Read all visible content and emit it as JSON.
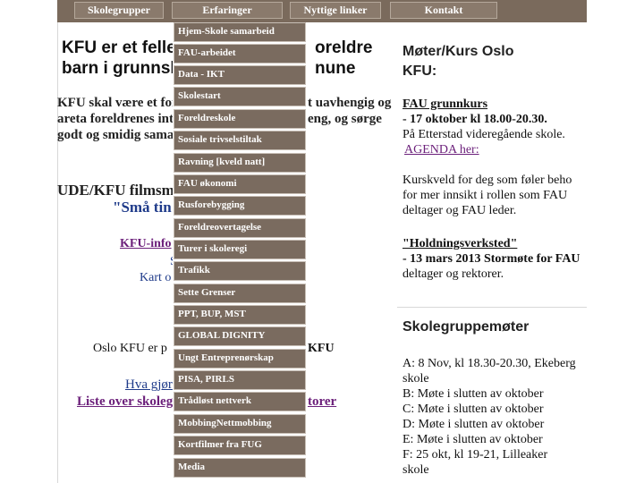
{
  "nav": {
    "items": [
      {
        "label": "Skolegrupper"
      },
      {
        "label": "Erfaringer"
      },
      {
        "label": "Nyttige linker"
      },
      {
        "label": "Kontakt"
      }
    ]
  },
  "dropdown": {
    "items": [
      "Hjem-Skole samarbeid",
      "FAU-arbeidet",
      "Data - IKT",
      "Skolestart",
      "Foreldreskole",
      "Sosiale trivselstiltak",
      "Ravning [kveld natt]",
      "FAU økonomi",
      "Rusforebygging",
      "Foreldreovertagelse",
      "Turer i skoleregi",
      "Trafikk",
      "Sette Grenser",
      "PPT, BUP, MST",
      "GLOBAL DIGNITY",
      "Ungt Entreprenørskap",
      "PISA, PIRLS",
      "Trådløst nettverk",
      "MobbingNettmobbing",
      "Kortfilmer fra FUG",
      "Media"
    ]
  },
  "main": {
    "heading_line1": "KFU er et felle",
    "heading_line1_right": "oreldre",
    "heading_line2": "barn i grunnsk",
    "heading_line2_right": "nune",
    "para_line1": "KFU skal være et forn",
    "para_line1_right": "t uavhengig og",
    "para_line2": "areta foreldrenes int",
    "para_line2_right": "eng, og sørge",
    "para_line3": "godt og smidig samar",
    "film_heading": "UDE/KFU filmsm",
    "film_title": "\"Små tin",
    "kfu_info": "KFU-info",
    "s_text": "S",
    "kart_text": "Kart o",
    "oslo_left": "Oslo KFU er p",
    "oslo_right": "KFU",
    "hva_text": "Hva gjør",
    "liste_text": "Liste over skoleg",
    "liste_right": "torer"
  },
  "right": {
    "moter_heading": "Møter/Kurs Oslo",
    "moter_heading2": "KFU:",
    "fau_link": "FAU grunnkurs",
    "fau_date": "- 17 oktober kl 18.00-20.30.",
    "fau_place": " På Etterstad videregående skole.",
    "agenda": "AGENDA her:",
    "kurs1": " Kurskveld for deg som føler beho",
    "kurs2": "for mer innsikt i rollen som FAU",
    "kurs3": "deltager og FAU leder.",
    "holdning": "\"Holdningsverksted\"",
    "holdning_date": "- 13 mars 2013 Stormøte for FAU",
    "holdning_txt": "deltager og rektorer.",
    "skole_heading": "Skolegruppemøter",
    "meeting_lines": [
      "A: 8 Nov, kl 18.30-20.30, Ekeberg",
      "skole",
      "B:  Møte i slutten av oktober",
      "C:  Møte i slutten av oktober",
      "D:  Møte i slutten av oktober",
      "E:  Møte i slutten av oktober",
      "F:  25 okt, kl 19-21, Lilleaker",
      "skole"
    ]
  },
  "colors": {
    "nav_bg": "#7a6a5c",
    "dropdown_item": "#7a6b5f",
    "link_blue": "#1f3b8a",
    "link_purple": "#6b1f7a"
  }
}
